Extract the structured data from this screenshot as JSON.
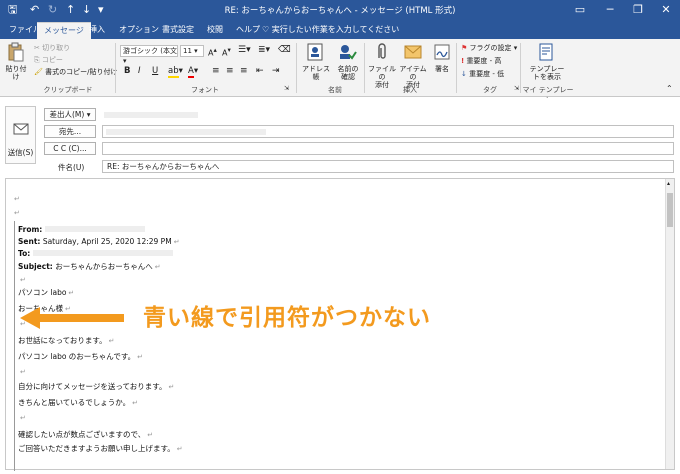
{
  "window": {
    "title": "RE: おーちゃんからおーちゃんへ  -  メッセージ (HTML 形式)"
  },
  "tabs": [
    "ファイル",
    "メッセージ",
    "挿入",
    "オプション",
    "書式設定",
    "校閲",
    "ヘルプ"
  ],
  "active_tab": "メッセージ",
  "tell_me": "実行したい作業を入力してください",
  "ribbon": {
    "clipboard": {
      "paste": "貼り付け",
      "cut": "切り取り",
      "copy": "コピー",
      "format_painter": "書式のコピー/貼り付け",
      "label": "クリップボード"
    },
    "font": {
      "font_name": "游ゴシック (本文",
      "font_size": "11",
      "label": "フォント"
    },
    "names": {
      "address_book": "アドレス帳",
      "check_names": "名前の\n確認",
      "label": "名前"
    },
    "include": {
      "attach_file": "ファイルの\n添付",
      "attach_item": "アイテムの\n添付",
      "signature": "署名",
      "label": "挿入"
    },
    "tags": {
      "flag": "フラグの設定",
      "high": "重要度 - 高",
      "low": "重要度 - 低",
      "label": "タグ"
    },
    "templates": {
      "view": "テンプレー\nトを表示",
      "label": "マイ テンプレート"
    }
  },
  "header": {
    "send": "送信(S)",
    "from_btn": "差出人(M)",
    "to_btn": "宛先...",
    "cc_btn": "C C (C)...",
    "subject_label": "件名(U)",
    "subject_value": "RE: おーちゃんからおーちゃんへ"
  },
  "body": {
    "from_label": "From:",
    "sent_label": "Sent:",
    "sent_value": "Saturday, April 25, 2020 12:29 PM",
    "to_label": "To:",
    "subject_label": "Subject:",
    "subject_value": "おーちゃんからおーちゃんへ",
    "lines": [
      "パソコン labo",
      "おーちゃん様",
      "",
      "お世話になっております。",
      "パソコン labo のおーちゃんです。",
      "",
      "自分に向けてメッセージを送っております。",
      "きちんと届いているでしょうか。",
      "",
      "確認したい点が数点ございますので、",
      "ご回答いただきますようお願い申し上げます。"
    ]
  },
  "annotation": "青い線で引用符がつかない",
  "colors": {
    "accent": "#2b579a",
    "annotation": "#f39a1e"
  }
}
